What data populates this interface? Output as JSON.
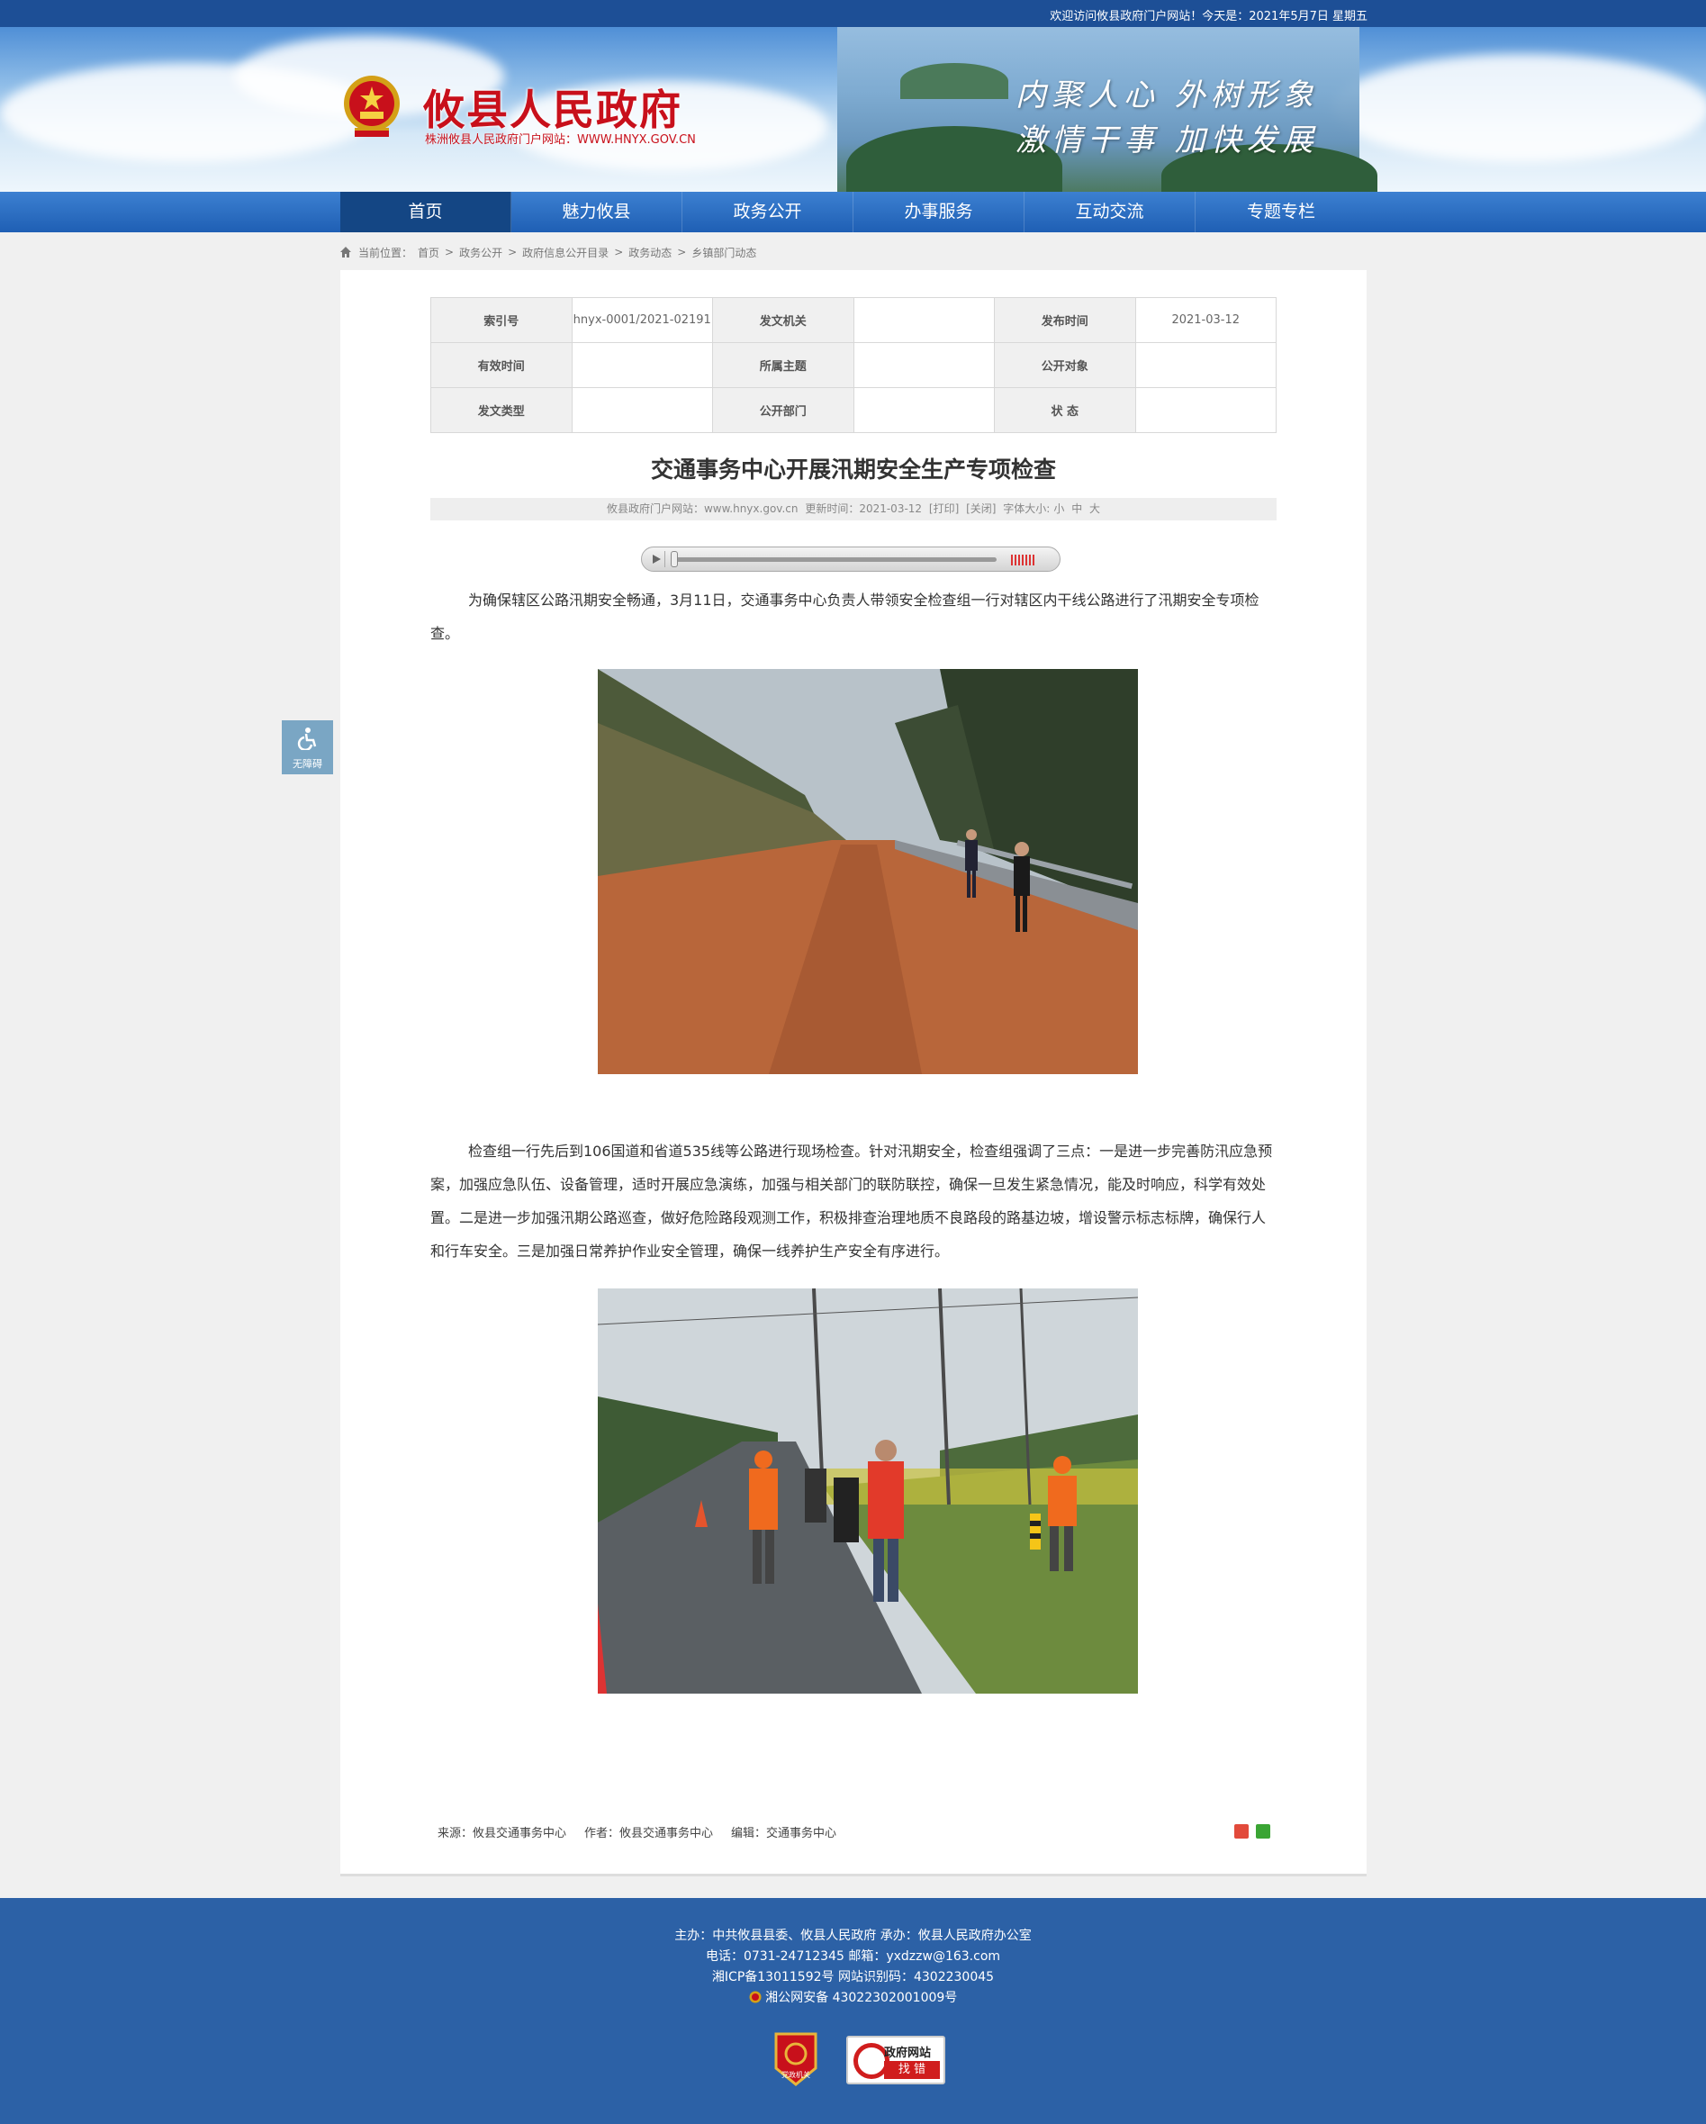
{
  "topbar": {
    "welcome": "欢迎访问攸县政府门户网站！今天是：2021年5月7日 星期五"
  },
  "header": {
    "title": "攸县人民政府",
    "subtitle": "株洲攸县人民政府门户网站：WWW.HNYX.GOV.CN",
    "slogan_1": "内聚人心  外树形象",
    "slogan_2": "激情干事  加快发展"
  },
  "nav": {
    "items": [
      "首页",
      "魅力攸县",
      "政务公开",
      "办事服务",
      "互动交流",
      "专题专栏"
    ]
  },
  "breadcrumb": {
    "label": "当前位置：",
    "items": [
      "首页",
      "政务公开",
      "政府信息公开目录",
      "政务动态",
      "乡镇部门动态"
    ],
    "separator": ">"
  },
  "meta": {
    "index_label": "索引号",
    "index_value": "hnyx-0001/2021-02191",
    "issuer_label": "发文机关",
    "issuer_value": "",
    "date_label": "发布时间",
    "date_value": "2021-03-12",
    "valid_label": "有效时间",
    "valid_value": "",
    "topic_label": "所属主题",
    "topic_value": "",
    "audience_label": "公开对象",
    "audience_value": "",
    "type_label": "发文类型",
    "type_value": "",
    "dept_label": "公开部门",
    "dept_value": "",
    "status_label": "状 态",
    "status_value": ""
  },
  "article": {
    "title": "交通事务中心开展汛期安全生产专项检查",
    "info": {
      "site": "攸县政府门户网站：www.hnyx.gov.cn",
      "updated": "更新时间：2021-03-12",
      "print": "[打印]",
      "close": "[关闭]",
      "font_label": "字体大小:",
      "font_small": "小",
      "font_medium": "中",
      "font_large": "大"
    },
    "para_1": "为确保辖区公路汛期安全畅通，3月11日，交通事务中心负责人带领安全检查组一行对辖区内干线公路进行了汛期安全专项检查。",
    "para_2": "检查组一行先后到106国道和省道535线等公路进行现场检查。针对汛期安全，检查组强调了三点：一是进一步完善防汛应急预案，加强应急队伍、设备管理，适时开展应急演练，加强与相关部门的联防联控，确保一旦发生紧急情况，能及时响应，科学有效处置。二是进一步加强汛期公路巡查，做好危险路段观测工作，积极排查治理地质不良路段的路基边坡，增设警示标志标牌，确保行人和行车安全。三是加强日常养护作业安全管理，确保一线养护生产安全有序进行。",
    "source": "来源：攸县交通事务中心",
    "author": "作者：攸县交通事务中心",
    "editor": "编辑：交通事务中心"
  },
  "accessibility": {
    "label": "无障碍"
  },
  "footer": {
    "line_1": "主办：中共攸县县委、攸县人民政府  承办：攸县人民政府办公室",
    "line_2": "电话：0731-24712345  邮箱：yxdzzw@163.com",
    "line_3": "湘ICP备13011592号    网站识别码：4302230045",
    "line_4": "湘公网安备 43022302001009号",
    "party_badge": "党政机关",
    "gov_badge_1": "政府网站",
    "gov_badge_2": "找 错"
  },
  "colors": {
    "brand_blue": "#1d4f96",
    "nav_active": "#144684",
    "title_red": "#c8101b",
    "footer_blue": "#2c61a6"
  }
}
